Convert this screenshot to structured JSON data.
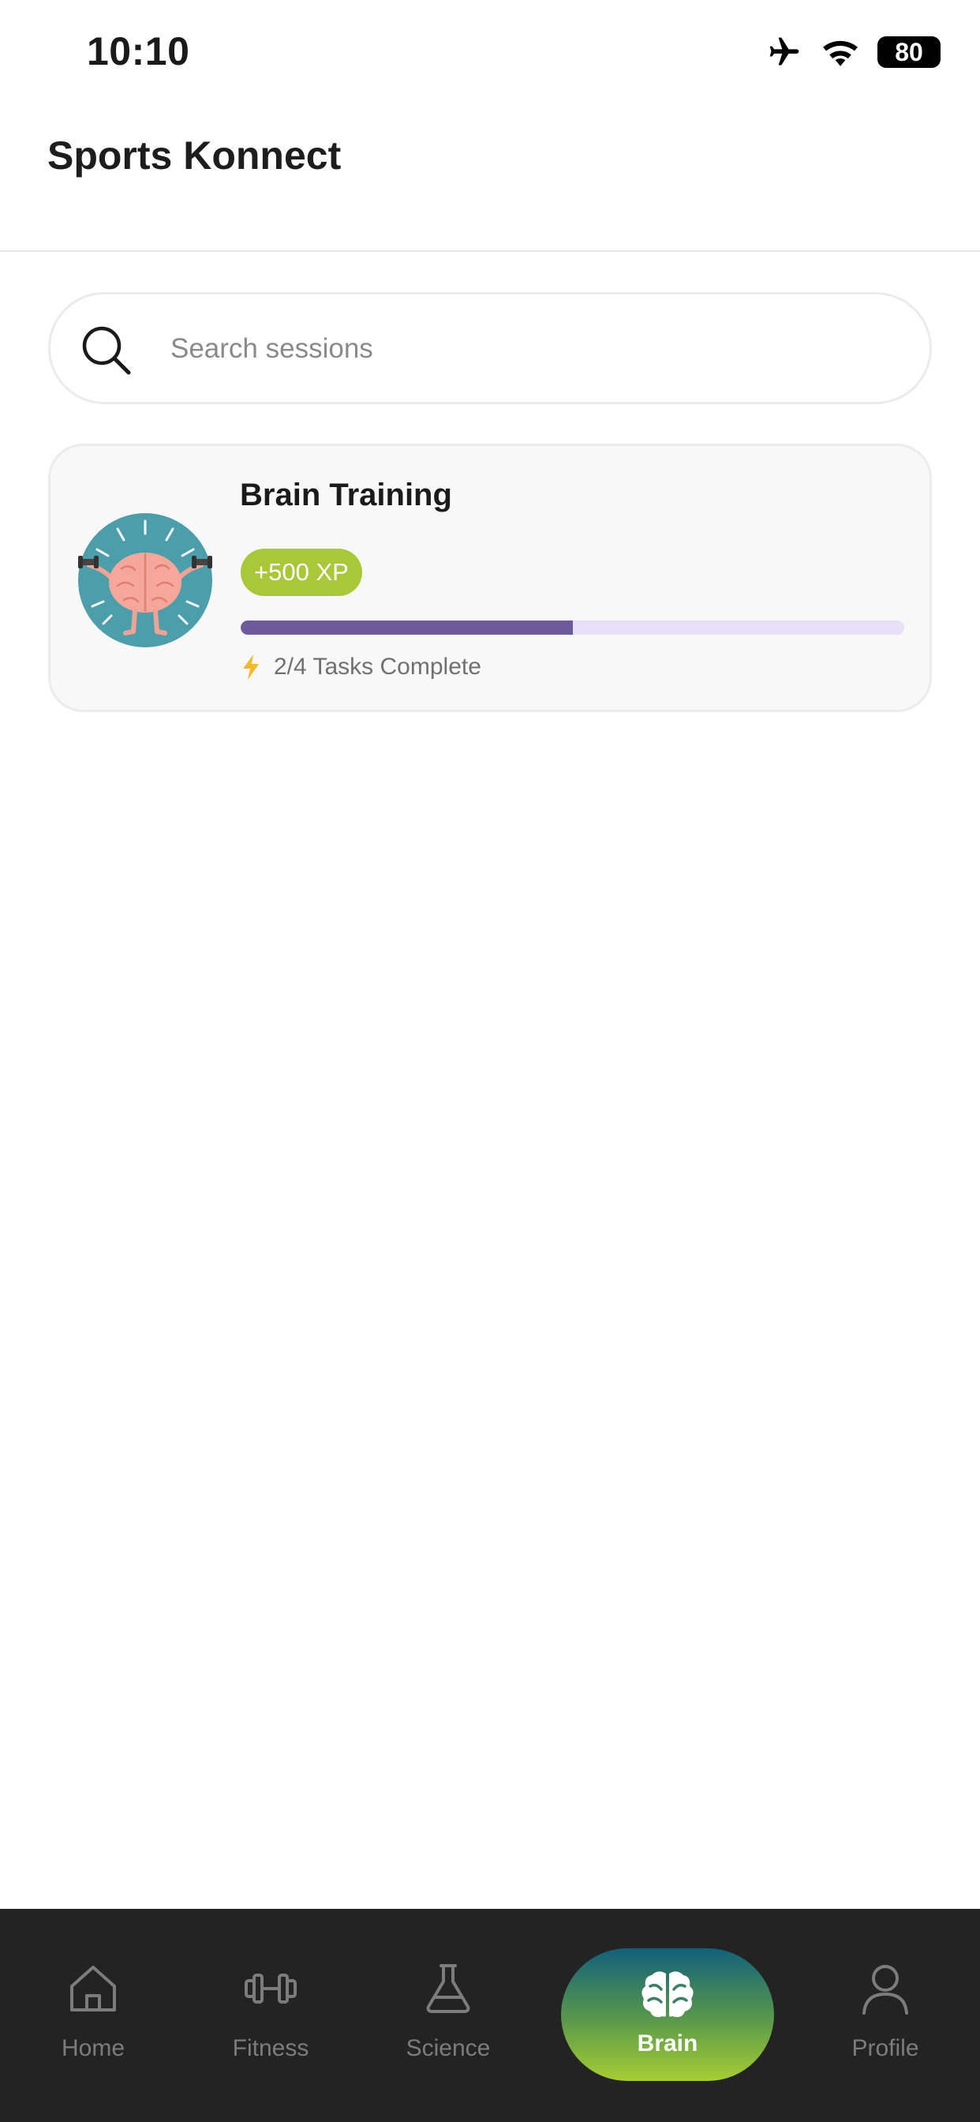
{
  "status_bar": {
    "time": "10:10",
    "battery": "80"
  },
  "header": {
    "title": "Sports Konnect"
  },
  "search": {
    "placeholder": "Search sessions",
    "value": ""
  },
  "sessions": [
    {
      "title": "Brain Training",
      "xp": "+500 XP",
      "progress": 0.5,
      "task_text": "2/4 Tasks Complete"
    }
  ],
  "nav": {
    "items": [
      {
        "label": "Home",
        "icon": "home-icon",
        "active": false
      },
      {
        "label": "Fitness",
        "icon": "dumbbell-icon",
        "active": false
      },
      {
        "label": "Science",
        "icon": "flask-icon",
        "active": false
      },
      {
        "label": "Brain",
        "icon": "brain-icon",
        "active": true
      },
      {
        "label": "Profile",
        "icon": "user-icon",
        "active": false
      }
    ]
  },
  "colors": {
    "xp_badge": "#a8c83a",
    "progress_fill": "#6d5a9a",
    "progress_track": "#e7e0f6",
    "nav_background": "#232323",
    "active_gradient_top": "#12607a",
    "active_gradient_bottom": "#a7cd33"
  }
}
